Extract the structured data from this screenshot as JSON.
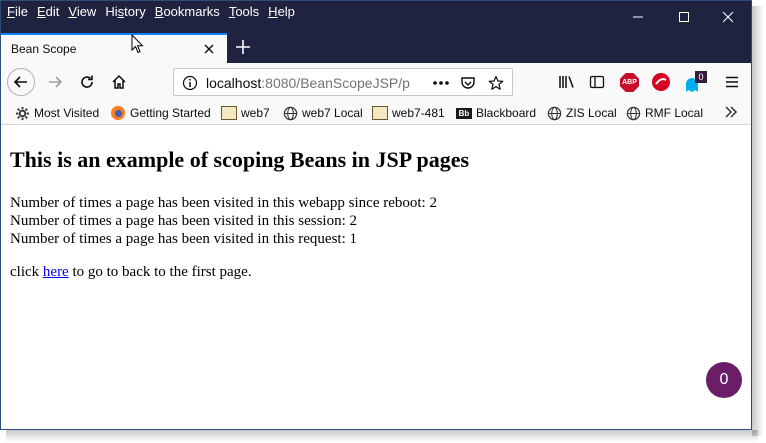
{
  "menu": {
    "items": [
      {
        "underline": "F",
        "rest": "ile"
      },
      {
        "underline": "E",
        "rest": "dit"
      },
      {
        "underline": "V",
        "rest": "iew"
      },
      {
        "pre": "Hi",
        "underline": "s",
        "rest": "tory"
      },
      {
        "underline": "B",
        "rest": "ookmarks"
      },
      {
        "underline": "T",
        "rest": "ools"
      },
      {
        "underline": "H",
        "rest": "elp"
      }
    ]
  },
  "tab": {
    "title": "Bean Scope"
  },
  "urlbar": {
    "host": "localhost",
    "path": ":8080/BeanScopeJSP/p"
  },
  "extensions": {
    "abp_label": "ABP",
    "ghost_badge": "0"
  },
  "bookmarks": [
    {
      "label": "Most Visited",
      "icon": "gear-icon"
    },
    {
      "label": "Getting Started",
      "icon": "firefox-icon"
    },
    {
      "label": "web7",
      "icon": "web-page-icon"
    },
    {
      "label": "web7 Local",
      "icon": "globe-icon"
    },
    {
      "label": "web7-481",
      "icon": "web-page-icon"
    },
    {
      "label": "Blackboard",
      "icon": "blackboard-icon"
    },
    {
      "label": "ZIS Local",
      "icon": "globe-icon"
    },
    {
      "label": "RMF Local",
      "icon": "globe-icon"
    }
  ],
  "blackboard_icon_text": "Bb",
  "page": {
    "heading": "This is an example of scoping Beans in JSP pages",
    "lines": [
      "Number of times a page has been visited in this webapp since reboot: 2",
      "Number of times a page has been visited in this session: 2",
      "Number of times a page has been visited in this request: 1"
    ],
    "click_prefix": "click ",
    "link_text": "here",
    "click_suffix": " to go to back to the first page."
  },
  "fab": {
    "count": "0"
  },
  "colors": {
    "titlebar": "#202340",
    "tab_accent": "#0a84ff",
    "link": "#0000ee",
    "fab": "#6b1e68"
  }
}
